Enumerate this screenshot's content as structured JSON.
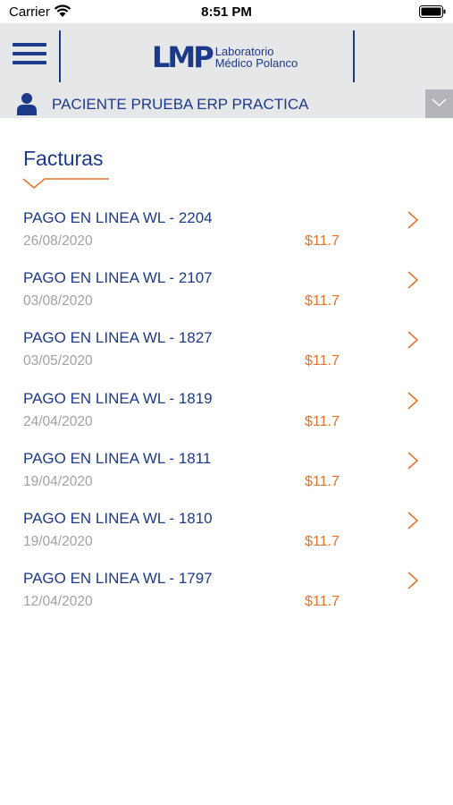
{
  "status_bar": {
    "carrier": "Carrier",
    "time": "8:51 PM",
    "wifi_icon": "wifi-icon",
    "battery_icon": "battery-icon"
  },
  "header": {
    "menu_icon": "hamburger-menu-icon",
    "logo": {
      "mark": "LMP",
      "line1": "Laboratorio",
      "line2": "Médico Polanco"
    }
  },
  "patient": {
    "icon": "user-icon",
    "name": "PACIENTE PRUEBA ERP PRACTICA",
    "dropdown_icon": "chevron-down-icon"
  },
  "section": {
    "title": "Facturas"
  },
  "invoices": [
    {
      "name": "PAGO EN LINEA WL - 2204",
      "date": "26/08/2020",
      "amount": "$11.7"
    },
    {
      "name": "PAGO EN LINEA WL - 2107",
      "date": "03/08/2020",
      "amount": "$11.7"
    },
    {
      "name": "PAGO EN LINEA WL - 1827",
      "date": "03/05/2020",
      "amount": "$11.7"
    },
    {
      "name": "PAGO EN LINEA WL - 1819",
      "date": "24/04/2020",
      "amount": "$11.7"
    },
    {
      "name": "PAGO EN LINEA WL - 1811",
      "date": "19/04/2020",
      "amount": "$11.7"
    },
    {
      "name": "PAGO EN LINEA WL - 1810",
      "date": "19/04/2020",
      "amount": "$11.7"
    },
    {
      "name": "PAGO EN LINEA WL - 1797",
      "date": "12/04/2020",
      "amount": "$11.7"
    }
  ],
  "colors": {
    "brand_blue": "#1d3a8a",
    "accent_orange": "#e8722b",
    "header_gray": "#e6e7e9",
    "date_gray": "#9fa1a4"
  }
}
